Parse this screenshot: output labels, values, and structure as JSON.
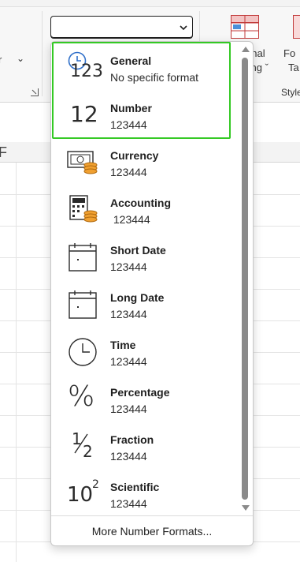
{
  "ribbon": {
    "left_fragment": "r",
    "cond_fragment_line1": "onal",
    "cond_fragment_line2": "ting ˇ",
    "fmt_fragment_line1": "Fo",
    "fmt_fragment_line2": "Ta",
    "styles_fragment": "Style",
    "column_fragment": "F"
  },
  "combo": {
    "value": ""
  },
  "dropdown": {
    "items": [
      {
        "label": "General",
        "sample": "No specific format",
        "icon": "clock-123-icon"
      },
      {
        "label": "Number",
        "sample": "123444",
        "icon": "number-12-icon"
      },
      {
        "label": "Currency",
        "sample": "123444",
        "icon": "currency-icon"
      },
      {
        "label": "Accounting",
        "sample": " 123444",
        "icon": "accounting-icon"
      },
      {
        "label": "Short Date",
        "sample": "123444",
        "icon": "calendar-icon"
      },
      {
        "label": "Long Date",
        "sample": "123444",
        "icon": "calendar-icon"
      },
      {
        "label": "Time",
        "sample": "123444",
        "icon": "clock-icon"
      },
      {
        "label": "Percentage",
        "sample": "123444",
        "icon": "percent-icon"
      },
      {
        "label": "Fraction",
        "sample": "123444",
        "icon": "fraction-icon"
      },
      {
        "label": "Scientific",
        "sample": "123444",
        "icon": "scientific-icon"
      }
    ],
    "glyphs": {
      "general_digits": "123",
      "number_digits": "12",
      "percent": "%",
      "fraction_num": "1",
      "fraction_den": "2",
      "sci_base": "10",
      "sci_exp": "2"
    },
    "more_label": "More Number Formats..."
  },
  "colors": {
    "highlight": "#34c924",
    "coin": "#f0a030",
    "scroll": "#8a8a8a"
  }
}
